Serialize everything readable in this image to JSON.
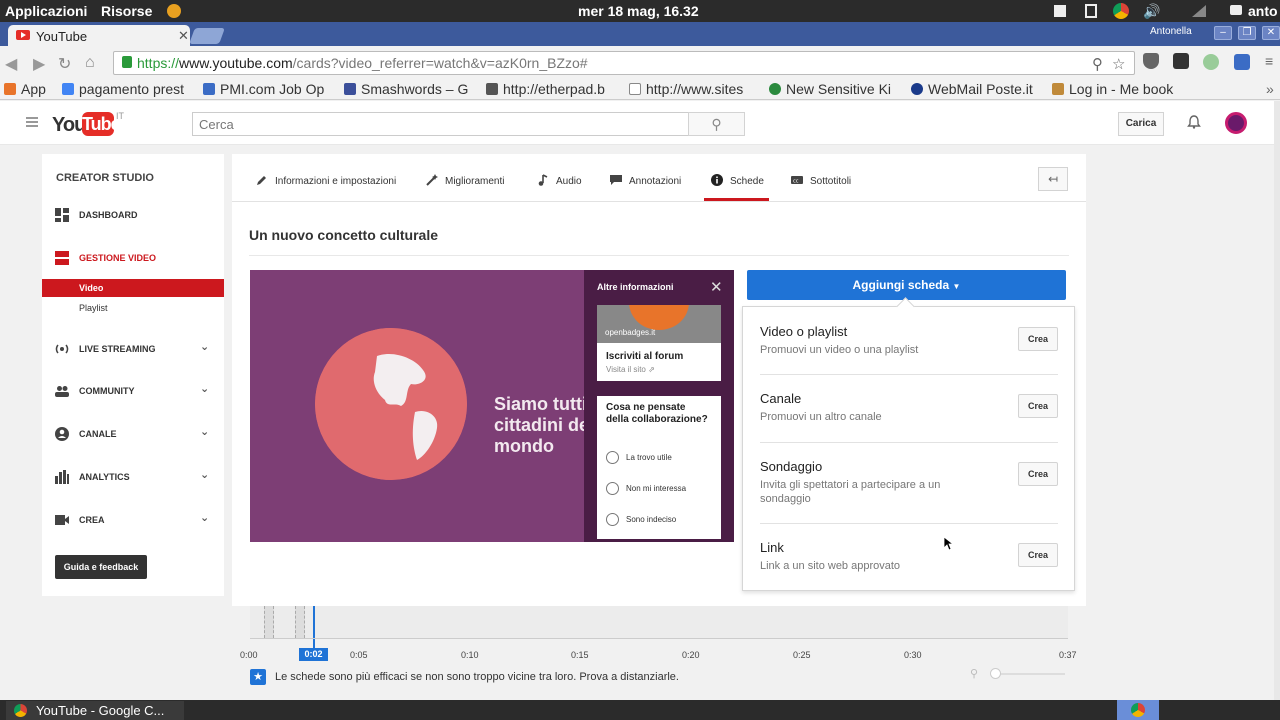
{
  "os": {
    "menu_apps": "Applicazioni",
    "menu_resources": "Risorse",
    "clock": "mer 18 mag, 16.32",
    "user": "anto"
  },
  "browser": {
    "tab_title": "YouTube",
    "window_user": "Antonella",
    "url_scheme": "https://",
    "url_host": "www.youtube.com",
    "url_path": "/cards?video_referrer=watch&v=azK0rn_BZzo#",
    "bookmarks": [
      {
        "label": "App",
        "color": "#e8742a"
      },
      {
        "label": "pagamento prest",
        "color": "#4285f4"
      },
      {
        "label": "PMI.com Job Op",
        "color": "#3b6cc5"
      },
      {
        "label": "Smashwords – G",
        "color": "#3b4f9a"
      },
      {
        "label": "http://etherpad.b",
        "color": "#555555"
      },
      {
        "label": "http://www.sites",
        "color": "#888888"
      },
      {
        "label": "New Sensitive Ki",
        "color": "#2b8a3e"
      },
      {
        "label": "WebMail Poste.it",
        "color": "#1a3a8a"
      },
      {
        "label": "Log in - Me book",
        "color": "#c08a3a"
      }
    ]
  },
  "youtube": {
    "logo_you": "You",
    "logo_tube": "Tube",
    "logo_country": "IT",
    "search_placeholder": "Cerca",
    "upload_label": "Carica"
  },
  "sidebar": {
    "title": "CREATOR STUDIO",
    "dashboard": "DASHBOARD",
    "video_manager": "GESTIONE VIDEO",
    "sub_video": "Video",
    "sub_playlist": "Playlist",
    "live": "LIVE STREAMING",
    "community": "COMMUNITY",
    "channel": "CANALE",
    "analytics": "ANALYTICS",
    "create": "CREA",
    "help": "Guida e feedback"
  },
  "editor_tabs": [
    {
      "label": "Informazioni e impostazioni"
    },
    {
      "label": "Miglioramenti"
    },
    {
      "label": "Audio"
    },
    {
      "label": "Annotazioni"
    },
    {
      "label": "Schede"
    },
    {
      "label": "Sottotitoli"
    }
  ],
  "video_title": "Un nuovo concetto culturale",
  "preview": {
    "overlay_text": "Siamo tutti\ncittadini de\nmondo",
    "panel_header": "Altre informazioni",
    "card1_brand": "openbadges.it",
    "card1_title": "Iscriviti al forum",
    "card1_sub": "Visita il sito",
    "poll_question": "Cosa ne pensate della collaborazione?",
    "poll_options": [
      "La trovo utile",
      "Non mi interessa",
      "Sono indeciso"
    ]
  },
  "add_card": {
    "button_label": "Aggiungi scheda",
    "items": [
      {
        "title": "Video o playlist",
        "desc": "Promuovi un video o una playlist",
        "action": "Crea"
      },
      {
        "title": "Canale",
        "desc": "Promuovi un altro canale",
        "action": "Crea"
      },
      {
        "title": "Sondaggio",
        "desc": "Invita gli spettatori a partecipare a un sondaggio",
        "action": "Crea"
      },
      {
        "title": "Link",
        "desc": "Link a un sito web approvato",
        "action": "Crea"
      }
    ]
  },
  "timeline": {
    "ticks": [
      "0:00",
      "0:05",
      "0:10",
      "0:15",
      "0:20",
      "0:25",
      "0:30",
      "0:37"
    ],
    "playhead": "0:02",
    "tip": "Le schede sono più efficaci se non sono troppo vicine tra loro. Prova a distanziarle."
  },
  "taskbar": {
    "window_label": "YouTube - Google C..."
  }
}
